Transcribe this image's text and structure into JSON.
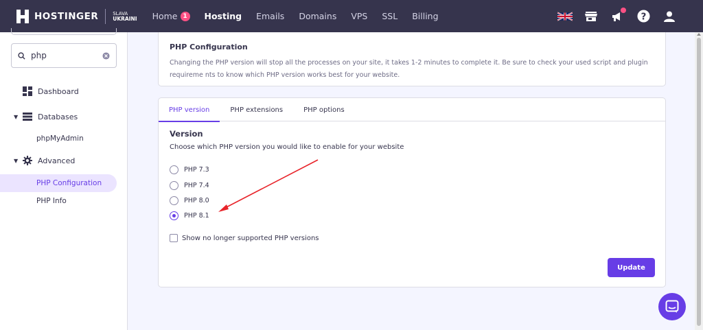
{
  "brand": {
    "name": "HOSTINGER",
    "tagline_top": "SLAVA",
    "tagline_bottom": "UKRAINI"
  },
  "nav": {
    "items": [
      {
        "label": "Home",
        "badge": "1"
      },
      {
        "label": "Hosting"
      },
      {
        "label": "Emails"
      },
      {
        "label": "Domains"
      },
      {
        "label": "VPS"
      },
      {
        "label": "SSL"
      },
      {
        "label": "Billing"
      }
    ],
    "active": "Hosting",
    "icons": [
      "uk-flag-icon",
      "store-icon",
      "megaphone-icon",
      "help-icon",
      "user-icon"
    ]
  },
  "sidebar": {
    "search": {
      "value": "php"
    },
    "items": [
      {
        "label": "Dashboard",
        "icon": "dashboard-icon"
      },
      {
        "label": "Databases",
        "icon": "databases-icon"
      },
      {
        "label": "phpMyAdmin"
      },
      {
        "label": "Advanced",
        "icon": "gear-icon"
      },
      {
        "label": "PHP Configuration"
      },
      {
        "label": "PHP Info"
      }
    ]
  },
  "config_card": {
    "title": "PHP Configuration",
    "description": "Changing the PHP version will stop all the processes on your site, it takes 1-2 minutes to complete it. Be sure to check your used script and plugin requireme nts to know which PHP version works best for your website."
  },
  "tabs": [
    {
      "label": "PHP version"
    },
    {
      "label": "PHP extensions"
    },
    {
      "label": "PHP options"
    }
  ],
  "version_section": {
    "title": "Version",
    "description": "Choose which PHP version you would like to enable for your website",
    "options": [
      {
        "label": "PHP 7.3"
      },
      {
        "label": "PHP 7.4"
      },
      {
        "label": "PHP 8.0"
      },
      {
        "label": "PHP 8.1"
      }
    ],
    "selected": "PHP 8.1",
    "checkbox_label": "Show no longer supported PHP versions",
    "update_label": "Update"
  },
  "colors": {
    "accent": "#673de6",
    "topbar": "#36344d",
    "arrow": "#e8242a"
  }
}
